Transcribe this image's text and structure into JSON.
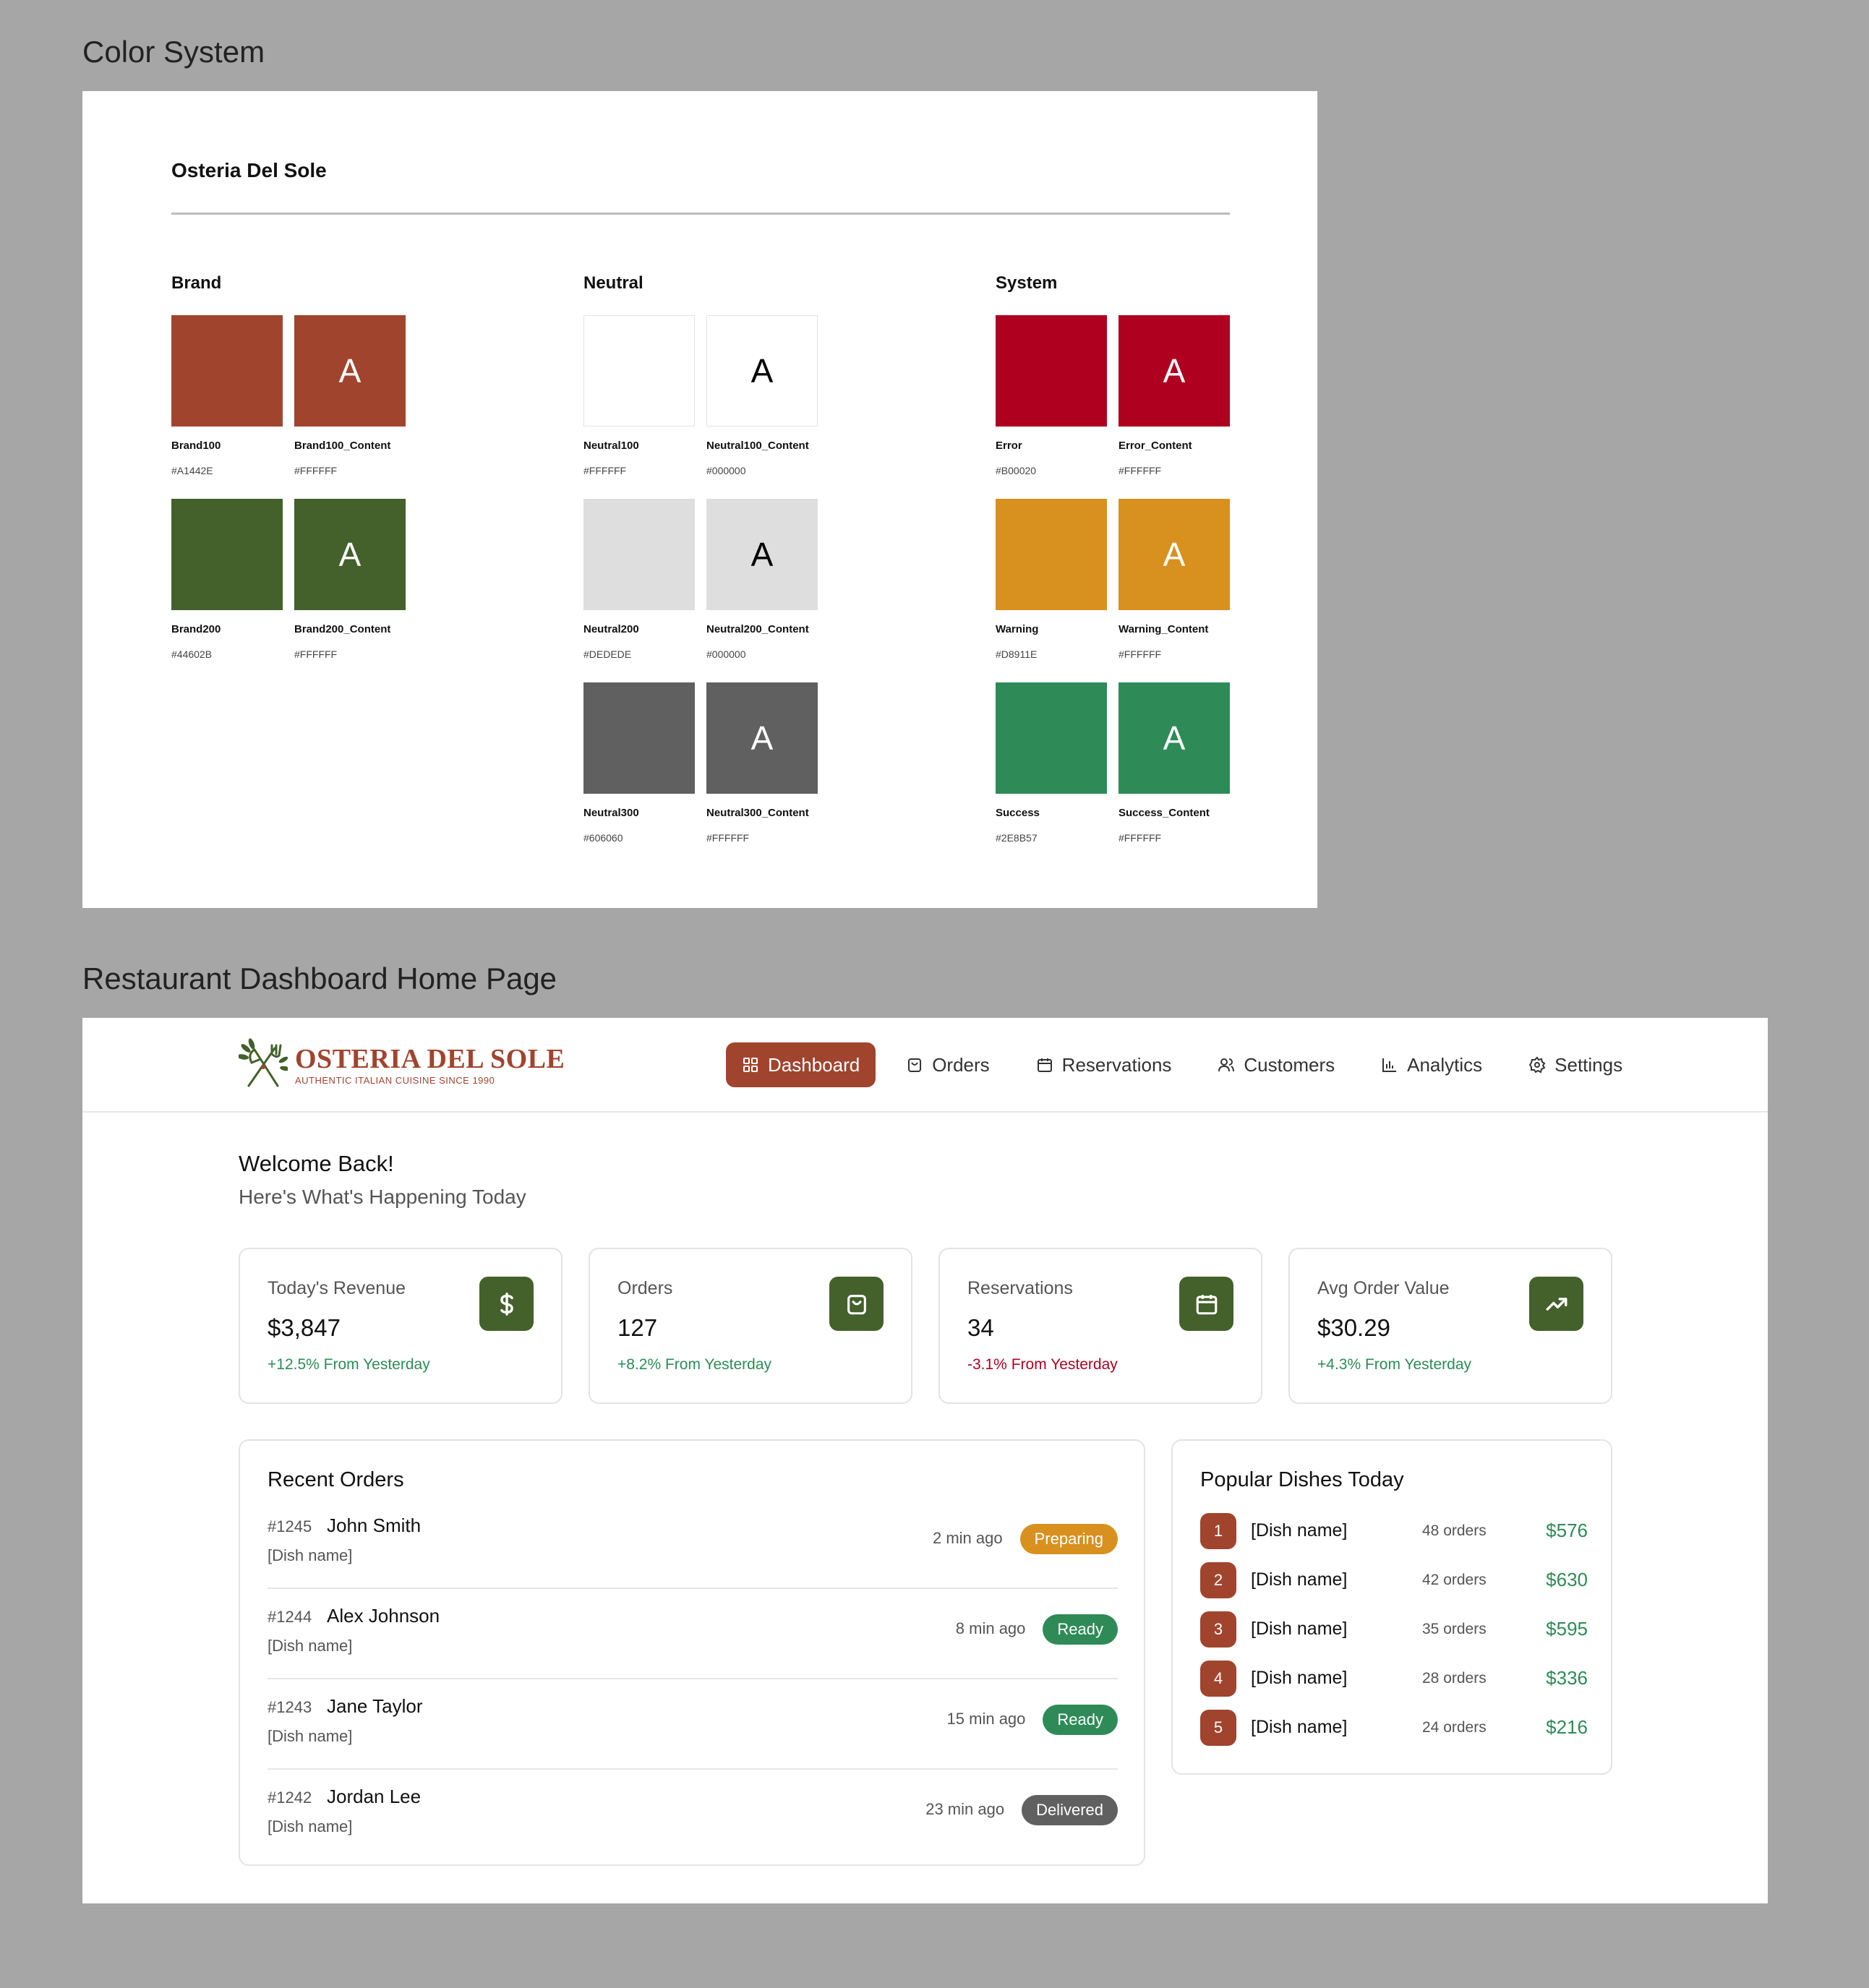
{
  "sections": {
    "color_system_title": "Color System",
    "dashboard_title": "Restaurant Dashboard Home Page"
  },
  "color_system": {
    "brand_name": "Osteria Del Sole",
    "sample_glyph": "A",
    "groups": [
      {
        "title": "Brand",
        "swatches": [
          {
            "name": "Brand100",
            "hex": "#A1442E",
            "color": "#A1442E",
            "glyph": "",
            "bordered": false
          },
          {
            "name": "Brand100_Content",
            "hex": "#FFFFFF",
            "color": "#A1442E",
            "glyph": "#FFFFFF",
            "bordered": false
          },
          {
            "name": "Brand200",
            "hex": "#44602B",
            "color": "#44602B",
            "glyph": "",
            "bordered": false
          },
          {
            "name": "Brand200_Content",
            "hex": "#FFFFFF",
            "color": "#44602B",
            "glyph": "#FFFFFF",
            "bordered": false
          }
        ]
      },
      {
        "title": "Neutral",
        "swatches": [
          {
            "name": "Neutral100",
            "hex": "#FFFFFF",
            "color": "#FFFFFF",
            "glyph": "",
            "bordered": true
          },
          {
            "name": "Neutral100_Content",
            "hex": "#000000",
            "color": "#FFFFFF",
            "glyph": "#000000",
            "bordered": true
          },
          {
            "name": "Neutral200",
            "hex": "#DEDEDE",
            "color": "#DEDEDE",
            "glyph": "",
            "bordered": false
          },
          {
            "name": "Neutral200_Content",
            "hex": "#000000",
            "color": "#DEDEDE",
            "glyph": "#000000",
            "bordered": false
          },
          {
            "name": "Neutral300",
            "hex": "#606060",
            "color": "#606060",
            "glyph": "",
            "bordered": false
          },
          {
            "name": "Neutral300_Content",
            "hex": "#FFFFFF",
            "color": "#606060",
            "glyph": "#FFFFFF",
            "bordered": false
          }
        ]
      },
      {
        "title": "System",
        "swatches": [
          {
            "name": "Error",
            "hex": "#B00020",
            "color": "#B00020",
            "glyph": "",
            "bordered": false
          },
          {
            "name": "Error_Content",
            "hex": "#FFFFFF",
            "color": "#B00020",
            "glyph": "#FFFFFF",
            "bordered": false
          },
          {
            "name": "Warning",
            "hex": "#D8911E",
            "color": "#D8911E",
            "glyph": "",
            "bordered": false
          },
          {
            "name": "Warning_Content",
            "hex": "#FFFFFF",
            "color": "#D8911E",
            "glyph": "#FFFFFF",
            "bordered": false
          },
          {
            "name": "Success",
            "hex": "#2E8B57",
            "color": "#2E8B57",
            "glyph": "",
            "bordered": false
          },
          {
            "name": "Success_Content",
            "hex": "#FFFFFF",
            "color": "#2E8B57",
            "glyph": "#FFFFFF",
            "bordered": false
          }
        ]
      }
    ]
  },
  "dashboard": {
    "logo": {
      "title": "OSTERIA DEL SOLE",
      "subtitle": "AUTHENTIC ITALIAN CUISINE SINCE 1990",
      "icon": "fork-knife-olive-branch-icon"
    },
    "nav": [
      {
        "label": "Dashboard",
        "icon": "grid-icon",
        "active": true
      },
      {
        "label": "Orders",
        "icon": "bag-icon",
        "active": false
      },
      {
        "label": "Reservations",
        "icon": "calendar-icon",
        "active": false
      },
      {
        "label": "Customers",
        "icon": "users-icon",
        "active": false
      },
      {
        "label": "Analytics",
        "icon": "chart-icon",
        "active": false
      },
      {
        "label": "Settings",
        "icon": "gear-icon",
        "active": false
      }
    ],
    "welcome": "Welcome Back!",
    "welcome_sub": "Here's What's Happening Today",
    "stats": [
      {
        "label": "Today's Revenue",
        "value": "$3,847",
        "change": "+12.5% From Yesterday",
        "trend": "up",
        "icon": "dollar-icon"
      },
      {
        "label": "Orders",
        "value": "127",
        "change": "+8.2% From Yesterday",
        "trend": "up",
        "icon": "bag-icon"
      },
      {
        "label": "Reservations",
        "value": "34",
        "change": "-3.1% From Yesterday",
        "trend": "down",
        "icon": "calendar-icon"
      },
      {
        "label": "Avg Order Value",
        "value": "$30.29",
        "change": "+4.3% From Yesterday",
        "trend": "up",
        "icon": "trending-up-icon"
      }
    ],
    "recent_orders": {
      "title": "Recent Orders",
      "rows": [
        {
          "id": "#1245",
          "name": "John Smith",
          "dish": "[Dish name]",
          "time": "2 min ago",
          "status": "Preparing",
          "status_color": "#D8911E"
        },
        {
          "id": "#1244",
          "name": "Alex Johnson",
          "dish": "[Dish name]",
          "time": "8 min ago",
          "status": "Ready",
          "status_color": "#2E8B57"
        },
        {
          "id": "#1243",
          "name": "Jane Taylor",
          "dish": "[Dish name]",
          "time": "15 min ago",
          "status": "Ready",
          "status_color": "#2E8B57"
        },
        {
          "id": "#1242",
          "name": "Jordan Lee",
          "dish": "[Dish name]",
          "time": "23 min ago",
          "status": "Delivered",
          "status_color": "#606060"
        }
      ]
    },
    "popular_dishes": {
      "title": "Popular Dishes Today",
      "rows": [
        {
          "rank": "1",
          "name": "[Dish name]",
          "orders": "48 orders",
          "revenue": "$576"
        },
        {
          "rank": "2",
          "name": "[Dish name]",
          "orders": "42 orders",
          "revenue": "$630"
        },
        {
          "rank": "3",
          "name": "[Dish name]",
          "orders": "35 orders",
          "revenue": "$595"
        },
        {
          "rank": "4",
          "name": "[Dish name]",
          "orders": "28 orders",
          "revenue": "$336"
        },
        {
          "rank": "5",
          "name": "[Dish name]",
          "orders": "24 orders",
          "revenue": "$216"
        }
      ]
    }
  }
}
